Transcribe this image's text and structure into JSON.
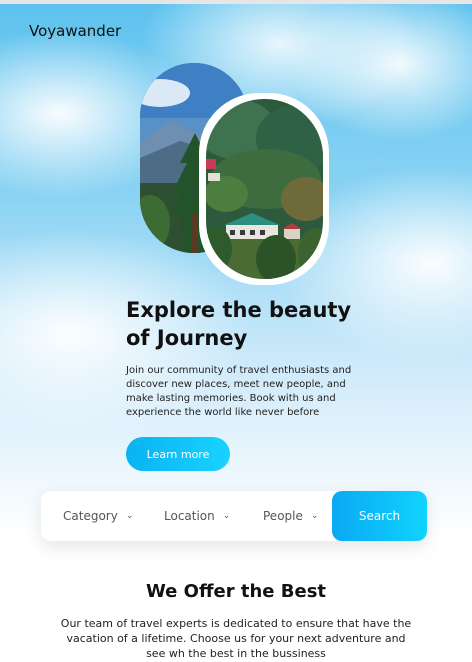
{
  "brand": {
    "name": "Voyawander"
  },
  "hero": {
    "title": "Explore the beauty of Journey",
    "description": "Join our community of travel enthusiasts and discover new places, meet new people, and make lasting memories. Book with us and experience the world like never before",
    "cta_label": "Learn more"
  },
  "search": {
    "filters": [
      {
        "label": "Category",
        "icon": "chevron-down-icon"
      },
      {
        "label": "Location",
        "icon": "chevron-down-icon"
      },
      {
        "label": "People",
        "icon": "chevron-down-icon"
      }
    ],
    "button_label": "Search"
  },
  "offer": {
    "title": "We Offer the Best",
    "description": "Our team of travel experts is dedicated to ensure that have the vacation of a lifetime. Choose us for your next adventure and see wh the best in the bussiness"
  },
  "colors": {
    "accent_start": "#09b3f1",
    "accent_end": "#19d2ff"
  }
}
